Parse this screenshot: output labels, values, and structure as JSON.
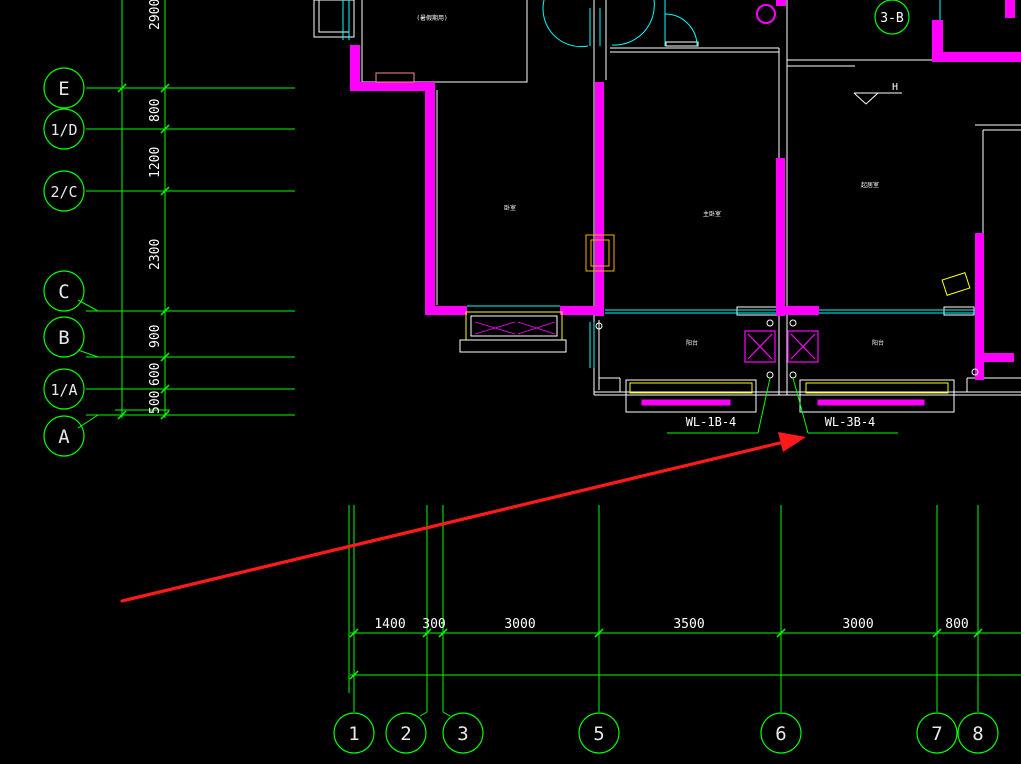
{
  "drawing": {
    "colors": {
      "background": "#000000",
      "grid_line": "#00ff00",
      "wall": "#ff00ff",
      "wall_outline": "#ffffff",
      "window": "#00ffff",
      "furniture": "#ffff00",
      "annotation_arrow": "#ff1a1a"
    },
    "row_axes": [
      "E",
      "1/D",
      "2/C",
      "C",
      "B",
      "1/A",
      "A"
    ],
    "column_axes": [
      "1",
      "2",
      "3",
      "5",
      "6",
      "7",
      "8"
    ],
    "vertical_dimensions": [
      "2900",
      "800",
      "1200",
      "2300",
      "900",
      "600",
      "500"
    ],
    "horizontal_dimensions": [
      "1400",
      "300",
      "3000",
      "3500",
      "3000",
      "800"
    ],
    "tags": {
      "left_riser": "WL-1B-4",
      "right_riser": "WL-3B-4",
      "unit_tag": "3-B",
      "elevation_mark": "H"
    },
    "room_labels": [
      "(暑假期用)",
      "卧室",
      "主卧室",
      "起居室",
      "阳台",
      "阳台"
    ]
  }
}
